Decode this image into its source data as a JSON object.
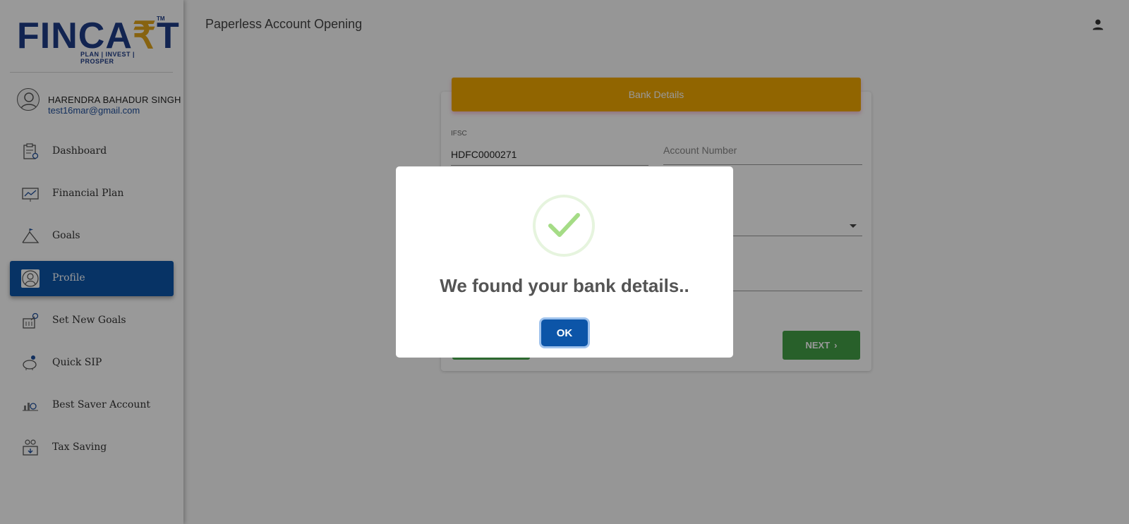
{
  "brand": {
    "name_part1": "FINCA",
    "name_r": "₹",
    "name_part2": "T",
    "tm": "TM",
    "tagline": "PLAN | INVEST | PROSPER"
  },
  "user": {
    "name": "HARENDRA BAHADUR SINGH",
    "email": "test16mar@gmail.com"
  },
  "sidebar": {
    "items": [
      {
        "label": "Dashboard",
        "icon": "clipboard-icon"
      },
      {
        "label": "Financial Plan",
        "icon": "chart-board-icon"
      },
      {
        "label": "Goals",
        "icon": "mountain-flag-icon"
      },
      {
        "label": "Profile",
        "icon": "profile-icon",
        "active": true
      },
      {
        "label": "Set New Goals",
        "icon": "target-building-icon"
      },
      {
        "label": "Quick SIP",
        "icon": "piggy-bank-icon"
      },
      {
        "label": "Best Saver Account",
        "icon": "savings-chart-icon"
      },
      {
        "label": "Tax Saving",
        "icon": "tax-saving-icon"
      }
    ]
  },
  "header": {
    "title": "Paperless Account Opening"
  },
  "form": {
    "section_title": "Bank Details",
    "ifsc_label": "IFSC",
    "ifsc_value": "HDFC0000271",
    "account_number_placeholder": "Account Number",
    "next_label": "NEXT"
  },
  "modal": {
    "title": "We found your bank details..",
    "ok_label": "OK"
  },
  "colors": {
    "brand_blue": "#1f3c88",
    "brand_gold": "#e2a51b",
    "active_nav": "#0c55a8",
    "header_bar": "#f2a800",
    "success_green": "#43a047",
    "check_green": "#a5dc86"
  }
}
